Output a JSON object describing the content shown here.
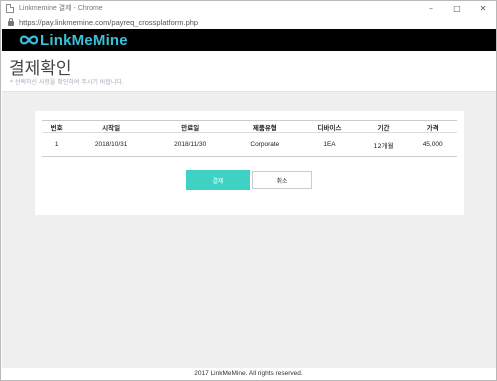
{
  "window": {
    "title": "Linkmemine 결제 - Chrome",
    "controls": {
      "minimize": "–",
      "maximize": "□",
      "close": "✕"
    }
  },
  "address": {
    "url": "https://pay.linkmemine.com/payreq_crossplatform.php"
  },
  "brand": {
    "logo_text": "LinkMeMine",
    "logo_color": "#38c1d8"
  },
  "header": {
    "title": "결제확인",
    "subtitle": "* 선택하신 사항을 확인하여 주시기 바랍니다."
  },
  "table": {
    "columns": [
      "번호",
      "시작일",
      "만료일",
      "제품유형",
      "디바이스",
      "기간",
      "가격"
    ],
    "rows": [
      {
        "no": "1",
        "start": "2018/10/31",
        "end": "2018/11/30",
        "type": "Corporate",
        "device": "1EA",
        "period": "12개월",
        "price": "45,000"
      }
    ]
  },
  "actions": {
    "pay_label": "결제",
    "cancel_label": "취소",
    "accent_color": "#3fd1c4"
  },
  "footer": {
    "copyright": "2017 LinkMeMine. All rights reserved."
  }
}
